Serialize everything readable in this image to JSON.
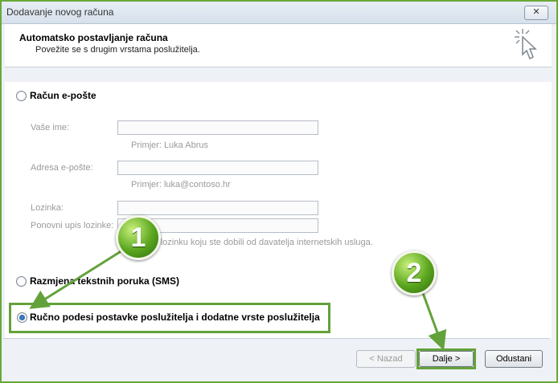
{
  "window": {
    "title": "Dodavanje novog računa",
    "close_label": "✕"
  },
  "header": {
    "title": "Automatsko postavljanje računa",
    "subtitle": "Povežite se s drugim vrstama poslužitelja."
  },
  "options": {
    "email_account": {
      "label": "Račun e-pošte",
      "selected": false
    },
    "sms": {
      "label": "Razmjena tekstnih poruka (SMS)",
      "selected": false
    },
    "manual": {
      "label": "Ručno podesi postavke poslužitelja i dodatne vrste poslužitelja",
      "selected": true
    }
  },
  "fields": {
    "name": {
      "label": "Vaše ime:",
      "value": "",
      "hint": "Primjer: Luka Abrus"
    },
    "email": {
      "label": "Adresa e-pošte:",
      "value": "",
      "hint": "Primjer: luka@contoso.hr"
    },
    "password": {
      "label": "Lozinka:",
      "value": ""
    },
    "retype": {
      "label": "Ponovni upis lozinke:",
      "value": "",
      "hint": "Upišite lozinku koju ste dobili od davatelja internetskih usluga."
    }
  },
  "buttons": {
    "back": "< Nazad",
    "next": "Dalje >",
    "cancel": "Odustani"
  },
  "annotations": {
    "step1": "1",
    "step2": "2",
    "color": "#63a23a"
  }
}
